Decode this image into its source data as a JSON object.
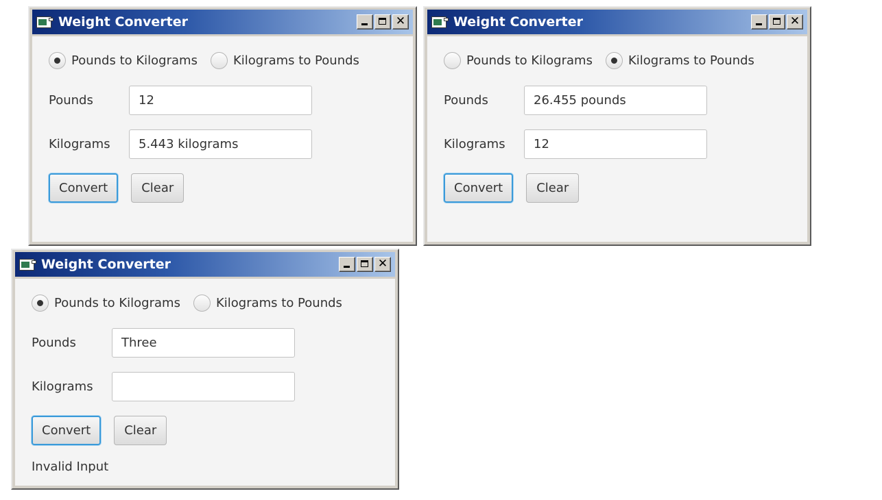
{
  "windows": [
    {
      "title": "Weight Converter",
      "close_glyph": "✕",
      "radios": [
        {
          "label": "Pounds to Kilograms",
          "checked": true
        },
        {
          "label": "Kilograms to Pounds",
          "checked": false
        }
      ],
      "pounds": {
        "label": "Pounds",
        "value": "12"
      },
      "kilograms": {
        "label": "Kilograms",
        "value": "5.443 kilograms"
      },
      "convert_label": "Convert",
      "clear_label": "Clear",
      "status": ""
    },
    {
      "title": "Weight Converter",
      "close_glyph": "✕",
      "radios": [
        {
          "label": "Pounds to Kilograms",
          "checked": false
        },
        {
          "label": "Kilograms to Pounds",
          "checked": true
        }
      ],
      "pounds": {
        "label": "Pounds",
        "value": "26.455 pounds"
      },
      "kilograms": {
        "label": "Kilograms",
        "value": "12"
      },
      "convert_label": "Convert",
      "clear_label": "Clear",
      "status": ""
    },
    {
      "title": "Weight Converter",
      "close_glyph": "✕",
      "radios": [
        {
          "label": "Pounds to Kilograms",
          "checked": true
        },
        {
          "label": "Kilograms to Pounds",
          "checked": false
        }
      ],
      "pounds": {
        "label": "Pounds",
        "value": "Three"
      },
      "kilograms": {
        "label": "Kilograms",
        "value": ""
      },
      "convert_label": "Convert",
      "clear_label": "Clear",
      "status": "Invalid Input"
    }
  ],
  "theme": {
    "titlebar_gradient": [
      "#0d2a77",
      "#a8c4e8"
    ],
    "client_bg": "#f4f4f4",
    "focus_ring": "#3a9ad9",
    "icons": [
      "app-window-icon",
      "minimize-icon",
      "maximize-icon",
      "close-icon",
      "radio-icon"
    ]
  }
}
